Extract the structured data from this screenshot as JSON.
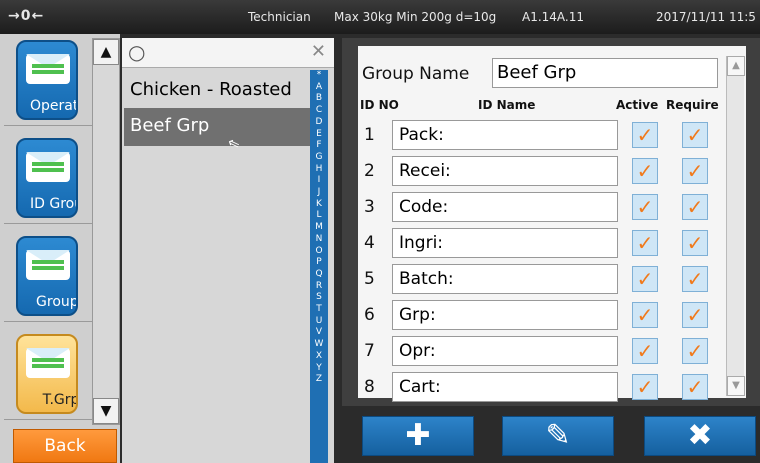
{
  "status": {
    "zero_indicator": "→0←",
    "user": "Technician",
    "capacity": "Max 30kg Min 200g d=10g",
    "version": "A1.14A.11",
    "datetime": "2017/11/11 11:5"
  },
  "nav": {
    "items": [
      {
        "label": "Operator"
      },
      {
        "label": "ID Group"
      },
      {
        "label": "Groups"
      },
      {
        "label": "T.Grp"
      }
    ],
    "back_label": "Back"
  },
  "list": {
    "search_placeholder": "",
    "items": [
      {
        "label": "Chicken - Roasted"
      },
      {
        "label": "Beef Grp"
      }
    ],
    "alphabet": [
      "*",
      "A",
      "B",
      "C",
      "D",
      "E",
      "F",
      "G",
      "H",
      "I",
      "J",
      "K",
      "L",
      "M",
      "N",
      "O",
      "P",
      "Q",
      "R",
      "S",
      "T",
      "U",
      "V",
      "W",
      "X",
      "Y",
      "Z"
    ]
  },
  "editor": {
    "group_name_label": "Group Name",
    "group_name_value": "Beef Grp",
    "headers": {
      "id_no": "ID NO",
      "id_name": "ID Name",
      "active": "Active",
      "require": "Require"
    },
    "rows": [
      {
        "no": "1",
        "name": "Pack:"
      },
      {
        "no": "2",
        "name": "Recei:"
      },
      {
        "no": "3",
        "name": "Code:"
      },
      {
        "no": "4",
        "name": "Ingri:"
      },
      {
        "no": "5",
        "name": "Batch:"
      },
      {
        "no": "6",
        "name": "Grp:"
      },
      {
        "no": "7",
        "name": "Opr:"
      },
      {
        "no": "8",
        "name": "Cart:"
      }
    ]
  },
  "actions": {
    "add_icon": "plus-icon",
    "edit_icon": "pencil-icon",
    "delete_icon": "x-icon"
  }
}
